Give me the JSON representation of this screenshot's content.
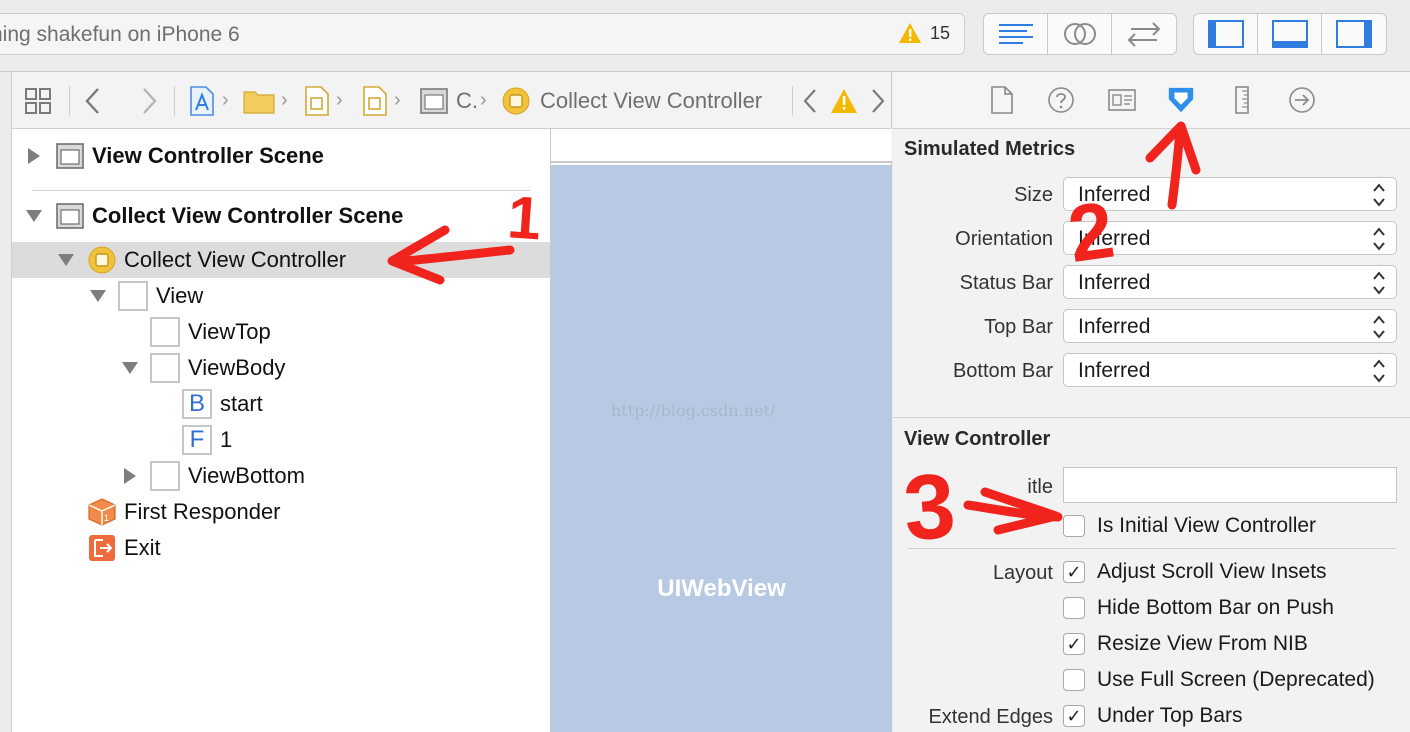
{
  "toolbar": {
    "activity_text": "ning shakefun on iPhone 6",
    "warning_count": "15",
    "editor_buttons": [
      "standard-editor-icon",
      "assistant-editor-icon",
      "version-editor-icon"
    ],
    "view_buttons": [
      "navigator-toggle-icon",
      "debug-area-toggle-icon",
      "utilities-toggle-icon"
    ]
  },
  "jumpbar": {
    "crumbs": [
      "",
      "",
      "",
      "",
      "C.",
      "Collect View Controller"
    ],
    "current": "Collect View Controller"
  },
  "outline": {
    "rows": [
      {
        "label": "View Controller Scene"
      },
      {
        "label": "Collect View Controller Scene"
      },
      {
        "label": "Collect View Controller"
      },
      {
        "label": "View"
      },
      {
        "label": "ViewTop"
      },
      {
        "label": "ViewBody"
      },
      {
        "label": "start",
        "icon_letter": "B"
      },
      {
        "label": "1",
        "icon_letter": "F"
      },
      {
        "label": "ViewBottom"
      },
      {
        "label": "First Responder"
      },
      {
        "label": "Exit"
      }
    ]
  },
  "canvas": {
    "webview_label": "UIWebView",
    "watermark": "http://blog.csdn.net/"
  },
  "inspector": {
    "tabs": [
      "file-icon",
      "help-icon",
      "identity-icon",
      "attributes-icon",
      "size-icon",
      "connections-icon"
    ],
    "simulated_metrics": {
      "title": "Simulated Metrics",
      "fields": [
        {
          "label": "Size",
          "value": "Inferred"
        },
        {
          "label": "Orientation",
          "value": "Inferred"
        },
        {
          "label": "Status Bar",
          "value": "Inferred"
        },
        {
          "label": "Top Bar",
          "value": "Inferred"
        },
        {
          "label": "Bottom Bar",
          "value": "Inferred"
        }
      ]
    },
    "view_controller": {
      "title": "View Controller",
      "title_label": "itle",
      "title_value": "",
      "initial_label": "Is Initial View Controller",
      "initial_checked": false,
      "layout_label": "Layout",
      "layout_options": [
        {
          "label": "Adjust Scroll View Insets",
          "checked": true
        },
        {
          "label": "Hide Bottom Bar on Push",
          "checked": false
        },
        {
          "label": "Resize View From NIB",
          "checked": true
        },
        {
          "label": "Use Full Screen (Deprecated)",
          "checked": false
        }
      ],
      "extend_label": "Extend Edges",
      "extend_options": [
        {
          "label": "Under Top Bars",
          "checked": true
        }
      ]
    }
  },
  "annotations": {
    "step1": "1",
    "step2": "2",
    "step3": "3"
  },
  "colors": {
    "annotation": "#f0241c",
    "webview": "#b8cae3",
    "accent": "#2f8fe8",
    "warning": "#f5b800"
  }
}
